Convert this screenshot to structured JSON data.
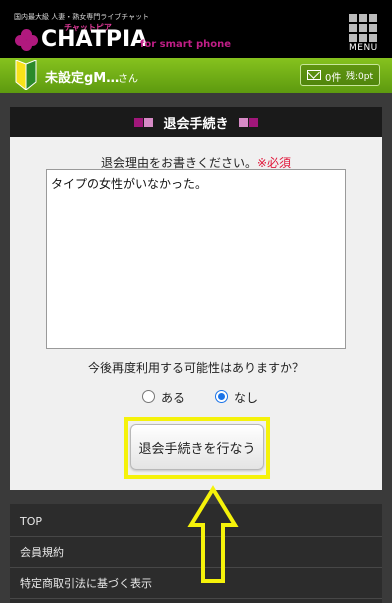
{
  "header": {
    "tagline": "国内最大級 人妻・熟女専門ライブチャット",
    "logo_kana": "チャットピア",
    "logo": "CHATPIA",
    "logo_sub": "for smart phone",
    "menu_label": "MENU"
  },
  "user_bar": {
    "username": "未設定gM…",
    "honorific": "さん",
    "mail_count": "0件",
    "points": "残:0pt"
  },
  "section": {
    "title": "退会手続き"
  },
  "form": {
    "reason_label": "退会理由をお書きください。",
    "required_mark": "※必須",
    "reason_value": "タイプの女性がいなかった。",
    "question": "今後再度利用する可能性はありますか？",
    "option_yes": "ある",
    "option_no": "なし",
    "selected_option": "なし",
    "submit_label": "退会手続きを行なう"
  },
  "footer": {
    "items": [
      "TOP",
      "会員規約",
      "特定商取引法に基づく表示"
    ]
  },
  "colors": {
    "accent_magenta": "#a0177a",
    "user_bar_green": "#76b81a",
    "highlight_yellow": "#f5f20a",
    "required_red": "#e0183b"
  },
  "icons": [
    "logo-flower-icon",
    "menu-grid-icon",
    "beginner-leaf-icon",
    "mail-icon",
    "up-arrow-annotation"
  ]
}
